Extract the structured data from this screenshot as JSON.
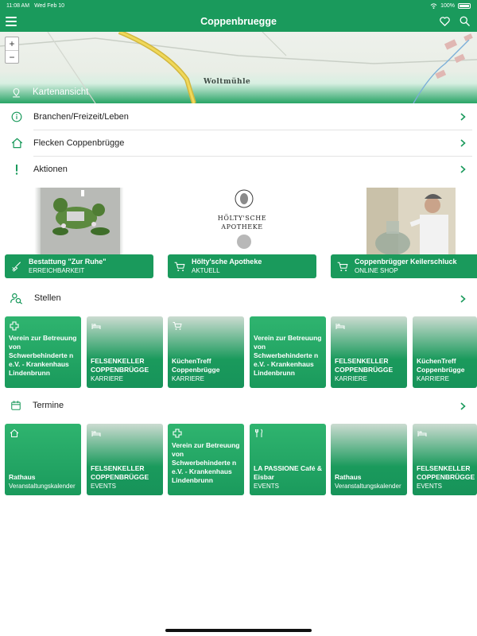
{
  "status_bar": {
    "time": "11:08 AM",
    "date": "Wed Feb 10",
    "battery": "100%"
  },
  "header": {
    "title": "Coppenbruegge"
  },
  "map": {
    "zoom_in": "+",
    "zoom_out": "−",
    "place_name": "Woltmühle",
    "label": "Kartenansicht"
  },
  "menu": [
    {
      "label": "Branchen/Freizeit/Leben"
    },
    {
      "label": "Flecken Coppenbrügge"
    },
    {
      "label": "Aktionen"
    }
  ],
  "promos": [
    {
      "title": "Bestattung \"Zur Ruhe\"",
      "subtitle": "ERREICHBARKEIT"
    },
    {
      "title": "Hölty'sche Apotheke",
      "subtitle": "AKTUELL",
      "logo_line1": "HÖLTY'SCHE",
      "logo_line2": "APOTHEKE"
    },
    {
      "title": "Coppenbrügger Keilerschluck",
      "subtitle": "ONLINE SHOP"
    }
  ],
  "stellen": {
    "label": "Stellen",
    "tiles": [
      {
        "name": "Verein zur Betreuung von Schwerbehinderte n e.V. - Krankenhaus Lindenbrunn",
        "sub": ""
      },
      {
        "name": "FELSENKELLER COPPENBRÜGGE",
        "sub": "KARRIERE"
      },
      {
        "name": "KüchenTreff Coppenbrügge",
        "sub": "KARRIERE"
      },
      {
        "name": "Verein zur Betreuung von Schwerbehinderte n e.V. - Krankenhaus Lindenbrunn",
        "sub": ""
      },
      {
        "name": "FELSENKELLER COPPENBRÜGGE",
        "sub": "KARRIERE"
      },
      {
        "name": "KüchenTreff Coppenbrügge",
        "sub": "KARRIERE"
      }
    ]
  },
  "termine": {
    "label": "Termine",
    "tiles": [
      {
        "name": "Rathaus",
        "sub": "Veranstaltungskalender"
      },
      {
        "name": "FELSENKELLER COPPENBRÜGGE",
        "sub": "EVENTS"
      },
      {
        "name": "Verein zur Betreuung von Schwerbehinderte n e.V. - Krankenhaus Lindenbrunn",
        "sub": ""
      },
      {
        "name": "LA PASSIONE Café & Eisbar",
        "sub": "EVENTS"
      },
      {
        "name": "Rathaus",
        "sub": "Veranstaltungskalender"
      },
      {
        "name": "FELSENKELLER COPPENBRÜGGE",
        "sub": "EVENTS"
      }
    ]
  },
  "colors": {
    "brand_green": "#1a9a5c"
  }
}
